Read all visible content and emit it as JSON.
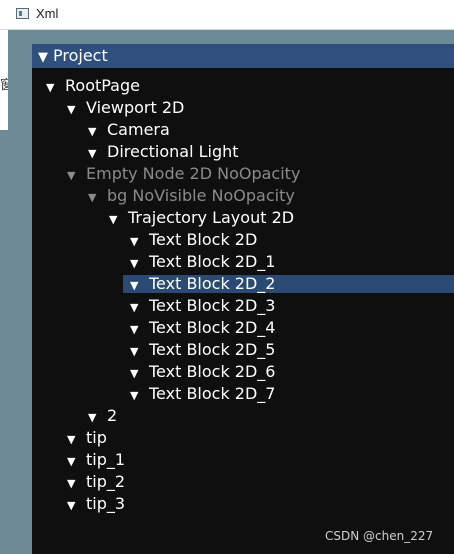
{
  "window": {
    "title": "Xml"
  },
  "left_strip": {
    "glyph": "窗"
  },
  "panel": {
    "title": "Project"
  },
  "tree": [
    {
      "label": "RootPage",
      "dim": false
    },
    {
      "label": "Viewport 2D",
      "dim": false
    },
    {
      "label": "Camera",
      "dim": false
    },
    {
      "label": "Directional Light",
      "dim": false
    },
    {
      "label": "Empty Node 2D NoOpacity",
      "dim": true
    },
    {
      "label": "bg NoVisible NoOpacity",
      "dim": true
    },
    {
      "label": "Trajectory Layout 2D",
      "dim": false
    },
    {
      "label": "Text Block 2D",
      "dim": false
    },
    {
      "label": "Text Block 2D_1",
      "dim": false
    },
    {
      "label": "Text Block 2D_2",
      "dim": false,
      "selected": true
    },
    {
      "label": "Text Block 2D_3",
      "dim": false
    },
    {
      "label": "Text Block 2D_4",
      "dim": false
    },
    {
      "label": "Text Block 2D_5",
      "dim": false
    },
    {
      "label": "Text Block 2D_6",
      "dim": false
    },
    {
      "label": "Text Block 2D_7",
      "dim": false
    },
    {
      "label": "2",
      "dim": false
    },
    {
      "label": "tip",
      "dim": false
    },
    {
      "label": "tip_1",
      "dim": false
    },
    {
      "label": "tip_2",
      "dim": false
    },
    {
      "label": "tip_3",
      "dim": false
    }
  ],
  "watermark": "CSDN @chen_227",
  "colors": {
    "selection": "#2a4a74",
    "header": "#2f4f7f",
    "panel_bg": "#0f0f10"
  }
}
